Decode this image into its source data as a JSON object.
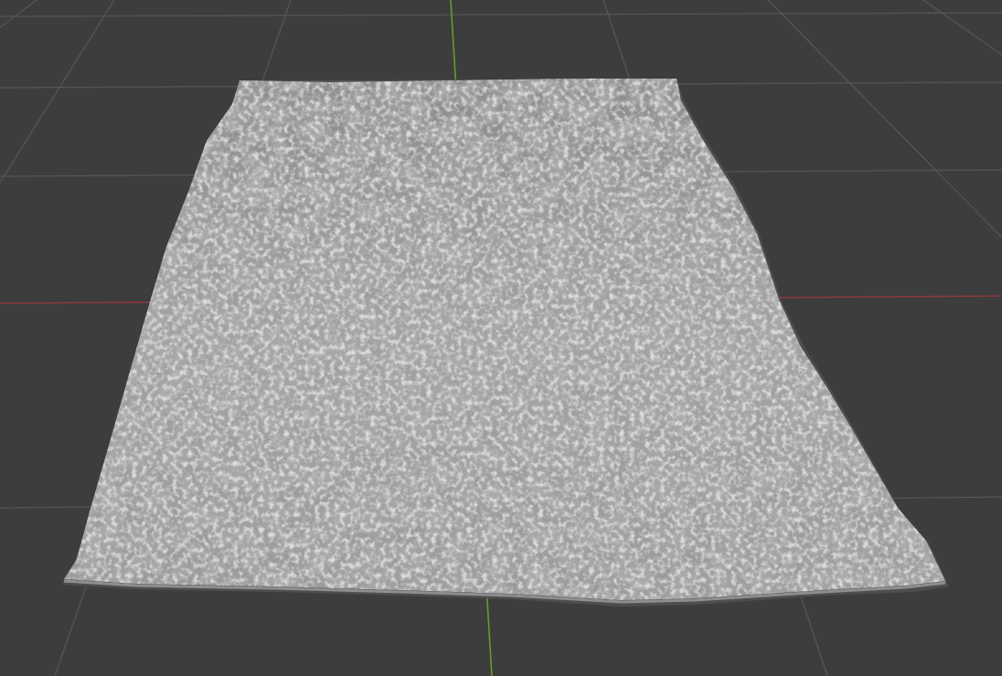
{
  "viewport": {
    "background_color": "#3d3d3d",
    "grid_line_color": "#555555",
    "x_axis_color": "#8a3a3a",
    "y_axis_color": "#6a9a2a"
  },
  "mesh": {
    "object_type": "displaced-plane",
    "surface_color": "#9a9a9a",
    "shadow_color": "#4e4e4e",
    "highlight_color": "#c8c8c8"
  }
}
